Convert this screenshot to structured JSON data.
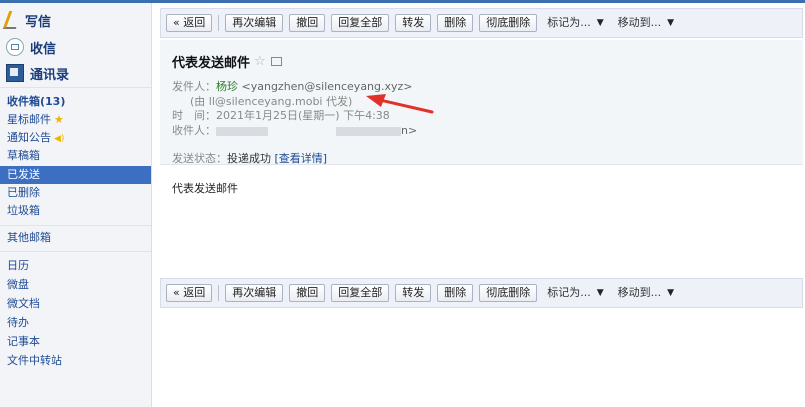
{
  "sidebar": {
    "compose": "写信",
    "receive": "收信",
    "contacts": "通讯录",
    "folders": [
      {
        "label": "收件箱(13)",
        "bold": true
      },
      {
        "label": "星标邮件"
      },
      {
        "label": "通知公告"
      },
      {
        "label": "草稿箱"
      },
      {
        "label": "已发送",
        "active": true
      },
      {
        "label": "已删除"
      },
      {
        "label": "垃圾箱"
      }
    ],
    "other_folders": "其他邮箱",
    "apps": [
      "日历",
      "微盘",
      "微文档",
      "待办",
      "记事本",
      "文件中转站"
    ]
  },
  "toolbar": {
    "back": "« 返回",
    "reedit": "再次编辑",
    "recall": "撤回",
    "reply_all": "回复全部",
    "forward": "转发",
    "delete": "删除",
    "delete_forever": "彻底删除",
    "mark_as": "标记为...",
    "move_to": "移动到..."
  },
  "mail": {
    "subject": "代表发送邮件",
    "from_label": "发件人：",
    "from_name": "杨珍",
    "from_addr": "<yangzhen@silenceyang.xyz>",
    "on_behalf": "(由 ll@silenceyang.mobi 代发)",
    "time_label": "时　间：",
    "time_value": "2021年1月25日(星期一) 下午4:38",
    "to_label": "收件人：",
    "to_tail": "n>",
    "status_label": "发送状态：",
    "status_value": "投递成功",
    "status_link": "[查看详情]",
    "body": "代表发送邮件"
  },
  "colors": {
    "accent": "#3c6fc2",
    "arrow": "#e0322a"
  }
}
